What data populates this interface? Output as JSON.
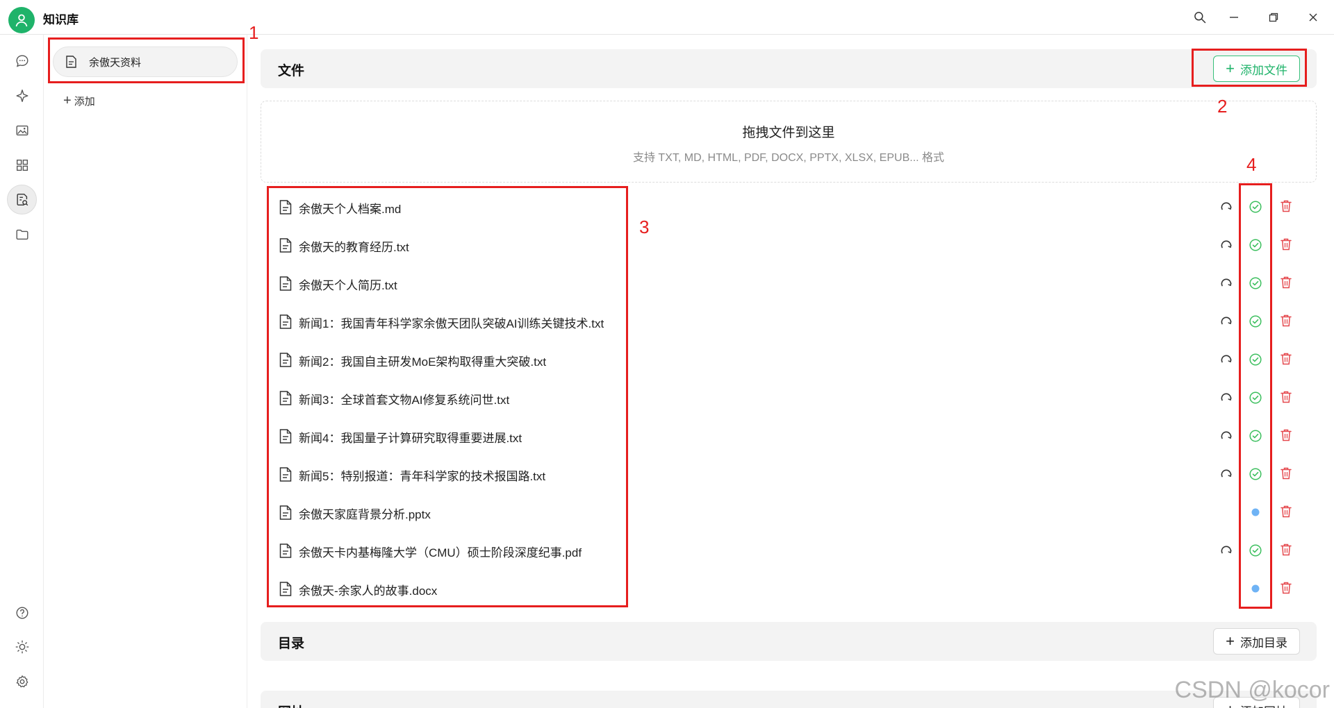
{
  "app": {
    "title": "知识库"
  },
  "rail": {
    "items": [
      {
        "icon": "chat-bubble-icon"
      },
      {
        "icon": "sparkle-icon"
      },
      {
        "icon": "image-icon"
      },
      {
        "icon": "apps-grid-icon"
      },
      {
        "icon": "knowledge-search-icon",
        "active": true
      },
      {
        "icon": "folder-icon"
      }
    ],
    "bottom": [
      {
        "icon": "help-icon"
      },
      {
        "icon": "theme-sun-icon"
      },
      {
        "icon": "settings-gear-icon"
      }
    ]
  },
  "kb_list": {
    "items": [
      {
        "label": "余傲天资料"
      }
    ],
    "add_label": "添加"
  },
  "files_section": {
    "title": "文件",
    "add_button": "添加文件",
    "dropzone_title": "拖拽文件到这里",
    "dropzone_hint": "支持 TXT, MD, HTML, PDF, DOCX, PPTX, XLSX, EPUB... 格式",
    "files": [
      {
        "name": "余傲天个人档案.md",
        "status": "done"
      },
      {
        "name": "余傲天的教育经历.txt",
        "status": "done"
      },
      {
        "name": "余傲天个人简历.txt",
        "status": "done"
      },
      {
        "name": "新闻1：我国青年科学家余傲天团队突破AI训练关键技术.txt",
        "status": "done"
      },
      {
        "name": "新闻2：我国自主研发MoE架构取得重大突破.txt",
        "status": "done"
      },
      {
        "name": "新闻3：全球首套文物AI修复系统问世.txt",
        "status": "done"
      },
      {
        "name": "新闻4：我国量子计算研究取得重要进展.txt",
        "status": "done"
      },
      {
        "name": "新闻5：特别报道：青年科学家的技术报国路.txt",
        "status": "done"
      },
      {
        "name": "余傲天家庭背景分析.pptx",
        "status": "pending"
      },
      {
        "name": "余傲天卡内基梅隆大学（CMU）硕士阶段深度纪事.pdf",
        "status": "done"
      },
      {
        "name": "余傲天-余家人的故事.docx",
        "status": "pending"
      }
    ]
  },
  "dir_section": {
    "title": "目录",
    "add_button": "添加目录"
  },
  "url_section": {
    "title": "网址",
    "add_button": "添加网址"
  },
  "annotations": [
    "1",
    "2",
    "3",
    "4"
  ],
  "watermark": "CSDN @kocor",
  "colors": {
    "accent": "#1fb36a",
    "done": "#3cbf5e",
    "pending": "#6fb3f5",
    "delete": "#e5484d",
    "annotation": "#e61e1e"
  }
}
